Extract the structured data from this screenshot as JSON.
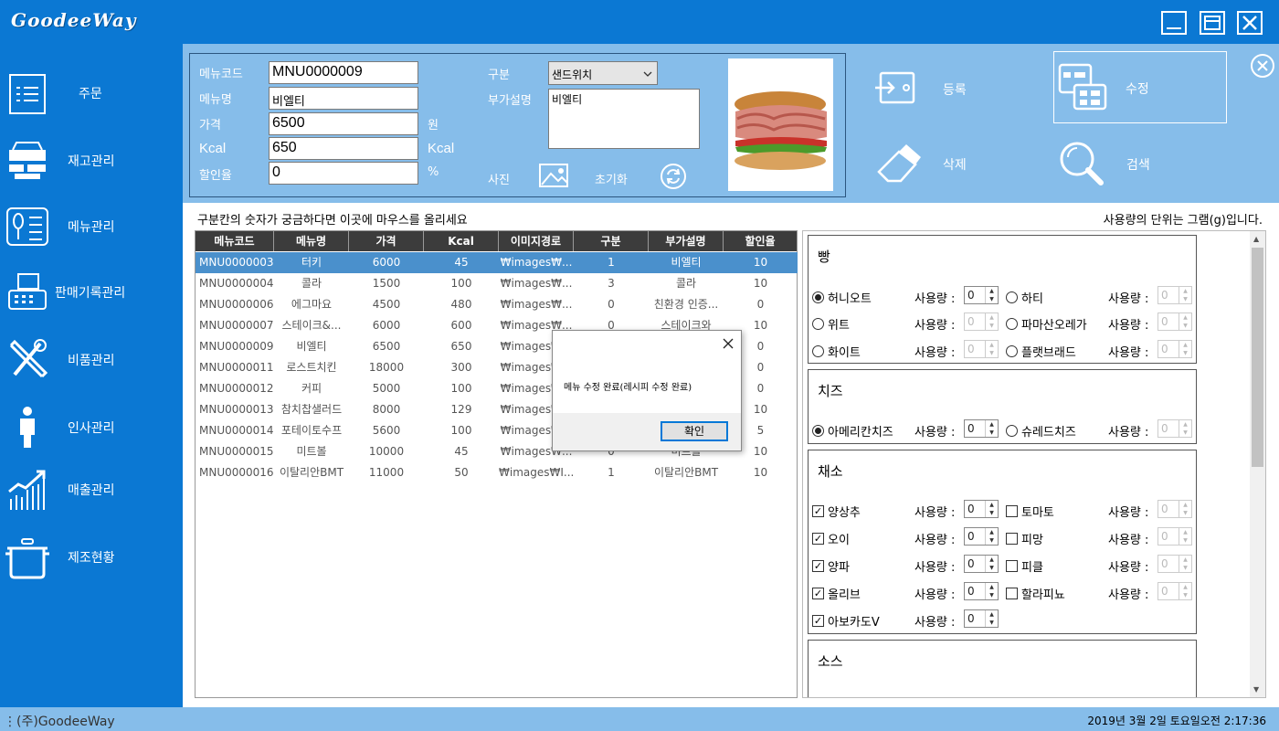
{
  "app": {
    "title": "GoodeeWay"
  },
  "sidebar": {
    "items": [
      {
        "label": "주문",
        "icon": "order-list-icon"
      },
      {
        "label": "재고관리",
        "icon": "inventory-icon"
      },
      {
        "label": "메뉴관리",
        "icon": "menu-icon"
      },
      {
        "label": "판매기록관리",
        "icon": "register-icon"
      },
      {
        "label": "비품관리",
        "icon": "tools-icon"
      },
      {
        "label": "인사관리",
        "icon": "person-icon"
      },
      {
        "label": "매출관리",
        "icon": "chart-icon"
      },
      {
        "label": "제조현황",
        "icon": "pot-icon"
      }
    ]
  },
  "form": {
    "code_label": "메뉴코드",
    "code_value": "MNU0000009",
    "name_label": "메뉴명",
    "name_value": "비엘티",
    "price_label": "가격",
    "price_value": "6500",
    "price_unit": "원",
    "kcal_label": "Kcal",
    "kcal_value": "650",
    "kcal_unit": "Kcal",
    "discount_label": "할인율",
    "discount_value": "0",
    "discount_unit": "%",
    "category_label": "구분",
    "category_value": "샌드위치",
    "desc_label": "부가설명",
    "desc_value": "비엘티",
    "photo_label": "사진",
    "reset_label": "초기화"
  },
  "actions": {
    "register": "등록",
    "edit": "수정",
    "delete": "삭제",
    "search": "검색"
  },
  "hint": "구분칸의 숫자가 궁금하다면 이곳에 마우스를 올리세요",
  "unit_hint": "사용량의 단위는 그램(g)입니다.",
  "table": {
    "columns": [
      "메뉴코드",
      "메뉴명",
      "가격",
      "Kcal",
      "이미지경로",
      "구분",
      "부가설명",
      "할인율"
    ],
    "rows": [
      [
        "MNU0000003",
        "터키",
        "6000",
        "45",
        "₩images₩...",
        "1",
        "비엘티",
        "10"
      ],
      [
        "MNU0000004",
        "콜라",
        "1500",
        "100",
        "₩images₩...",
        "3",
        "콜라",
        "10"
      ],
      [
        "MNU0000006",
        "에그마요",
        "4500",
        "480",
        "₩images₩...",
        "0",
        "친환경 인증...",
        "0"
      ],
      [
        "MNU0000007",
        "스테이크&...",
        "6000",
        "600",
        "₩images₩...",
        "0",
        "스테이크와",
        "10"
      ],
      [
        "MNU0000009",
        "비엘티",
        "6500",
        "650",
        "₩images₩...",
        "",
        "",
        "0"
      ],
      [
        "MNU0000011",
        "로스트치킨",
        "18000",
        "300",
        "₩images₩...",
        "",
        "",
        "0"
      ],
      [
        "MNU0000012",
        "커피",
        "5000",
        "100",
        "₩images₩...",
        "",
        "",
        "0"
      ],
      [
        "MNU0000013",
        "참치찹샐러드",
        "8000",
        "129",
        "₩images₩...",
        "",
        "",
        "10"
      ],
      [
        "MNU0000014",
        "포테이토수프",
        "5600",
        "100",
        "₩images₩...",
        "",
        "",
        "5"
      ],
      [
        "MNU0000015",
        "미트볼",
        "10000",
        "45",
        "₩images₩...",
        "0",
        "미트볼",
        "10"
      ],
      [
        "MNU0000016",
        "이탈리안BMT",
        "11000",
        "50",
        "₩images₩I...",
        "1",
        "이탈리안BMT",
        "10"
      ]
    ]
  },
  "ingredients": {
    "usage_label": "사용량 :",
    "bread": {
      "title": "빵",
      "items": [
        "허니오트",
        "하티",
        "위트",
        "파마산오레가",
        "화이트",
        "플랫브래드"
      ]
    },
    "cheese": {
      "title": "치즈",
      "items": [
        "아메리칸치즈",
        "슈레드치즈"
      ]
    },
    "veg": {
      "title": "채소",
      "items": [
        "양상추",
        "토마토",
        "오이",
        "피망",
        "양파",
        "피클",
        "올리브",
        "할라피뇨",
        "아보카도V"
      ]
    },
    "sauce": {
      "title": "소스"
    },
    "spin_value": "0"
  },
  "dialog": {
    "message": "메뉴 수정 완료(레시피 수정 완료)",
    "ok": "확인",
    "close": "×"
  },
  "status": {
    "company": "(주)GoodeeWay",
    "datetime": "2019년 3월 2일 토요일오전 2:17:36"
  }
}
